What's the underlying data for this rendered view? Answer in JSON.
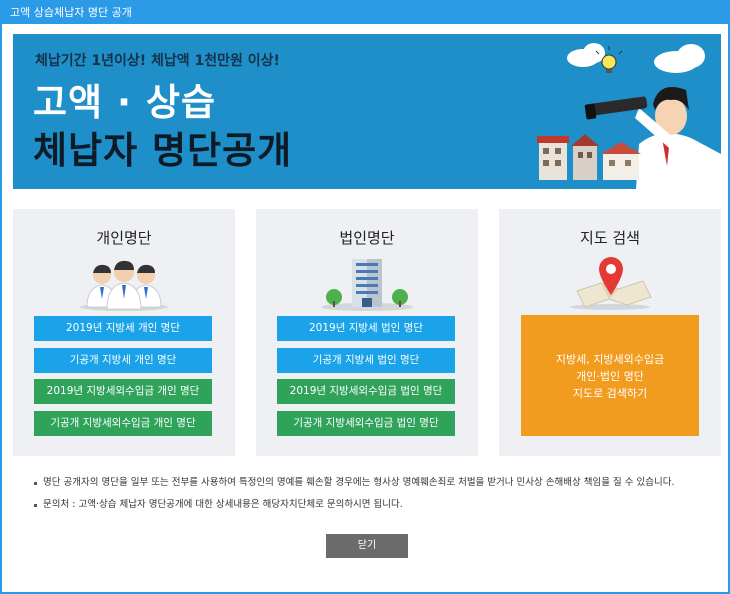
{
  "window": {
    "title": "고액 상습체납자 명단 공개"
  },
  "banner": {
    "subtitle": "체납기간 1년이상! 체납액 1천만원 이상!",
    "title_line1": "고액 · 상습",
    "title_line2": "체납자 명단공개"
  },
  "panels": {
    "personal": {
      "title": "개인명단",
      "buttons": [
        "2019년 지방세 개인 명단",
        "기공개 지방세 개인 명단",
        "2019년 지방세외수입금 개인 명단",
        "기공개 지방세외수입금 개인 명단"
      ]
    },
    "corporate": {
      "title": "법인명단",
      "buttons": [
        "2019년 지방세 법인 명단",
        "기공개 지방세 법인 명단",
        "2019년 지방세외수입금 법인 명단",
        "기공개 지방세외수입금 법인 명단"
      ]
    },
    "map": {
      "title": "지도 검색",
      "lines": [
        "지방세, 지방세외수입금",
        "개인·법인 명단",
        "지도로 검색하기"
      ]
    }
  },
  "notes": [
    "명단 공개자의 명단을 일부 또는 전부를 사용하여 특정인의 명예를 훼손할 경우에는 형사상 명예훼손죄로 처벌을 받거나 민사상 손해배상 책임을 질 수 있습니다.",
    "문의처 : 고액·상습 체납자 명단공개에 대한 상세내용은 해당자치단체로 문의하시면 됩니다."
  ],
  "close_label": "닫기",
  "colors": {
    "title_bar": "#2b9be8",
    "banner": "#1e8fc8",
    "blue_button": "#1aa3e8",
    "green_button": "#30a35b",
    "orange_box": "#f29c1f",
    "close_button": "#6b6b6b"
  }
}
